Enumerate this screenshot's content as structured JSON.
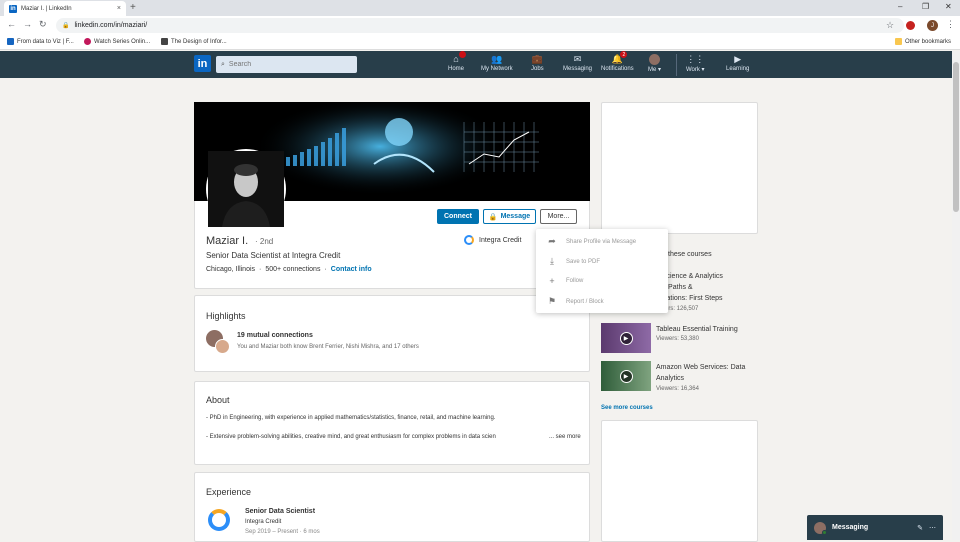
{
  "browser": {
    "tab_title": "Maziar I. | LinkedIn",
    "tab_close": "×",
    "new_tab": "+",
    "url": "linkedin.com/in/maziari/",
    "bookmarks": [
      "From data to Viz | F...",
      "Watch Series Onlin...",
      "The Design of Infor..."
    ],
    "other_bookmarks": "Other bookmarks",
    "profile_initial": "J"
  },
  "linkedin_nav": {
    "logo": "in",
    "search_placeholder": "Search",
    "items": [
      {
        "label": "Home",
        "icon": "home-icon",
        "badge": "•"
      },
      {
        "label": "My Network",
        "icon": "network-icon"
      },
      {
        "label": "Jobs",
        "icon": "jobs-icon"
      },
      {
        "label": "Messaging",
        "icon": "messaging-icon"
      },
      {
        "label": "Notifications",
        "icon": "bell-icon",
        "badge": "2"
      },
      {
        "label": "Me ▾",
        "icon": "me-avatar"
      },
      {
        "label": "Work ▾",
        "icon": "grid-icon"
      },
      {
        "label": "Learning",
        "icon": "learning-icon"
      }
    ]
  },
  "profile": {
    "name": "Maziar I.",
    "degree": "· 2nd",
    "headline": "Senior Data Scientist at Integra Credit",
    "location": "Chicago, Illinois",
    "connections": "500+ connections",
    "separator": "·",
    "contact_info": "Contact info",
    "company": "Integra Credit",
    "connect_label": "Connect",
    "message_label": "Message",
    "more_label": "More..."
  },
  "more_menu": {
    "items": [
      {
        "label": "Share Profile via Message",
        "icon": "share-icon"
      },
      {
        "label": "Save to PDF",
        "icon": "download-icon"
      },
      {
        "label": "Follow",
        "icon": "plus-icon"
      },
      {
        "label": "Report / Block",
        "icon": "flag-icon"
      }
    ]
  },
  "highlights": {
    "title": "Highlights",
    "mutual_title": "19 mutual connections",
    "mutual_sub": "You and Maziar both know Brent Ferrier, Nishi Mishra, and 17 others"
  },
  "about": {
    "title": "About",
    "line1": "- PhD in Engineering, with experience in applied mathematics/statistics, finance, retail, and machine learning.",
    "line2": "- Extensive problem-solving abilities, creative mind, and great enthusiasm for complex problems in data scien",
    "see_more": "... see more"
  },
  "experience": {
    "title": "Experience",
    "role": "Senior Data Scientist",
    "company": "Integra Credit",
    "dates": "Sep 2019 – Present · 6 mos"
  },
  "sidebar": {
    "courses_header": "these courses",
    "courses": [
      {
        "title_lines": [
          "a Science & Analytics",
          "eer Paths &",
          "tifications: First Steps"
        ],
        "viewers": "iewers: 126,507"
      },
      {
        "title_lines": [
          "Tableau Essential Training"
        ],
        "viewers": "Viewers: 53,380"
      },
      {
        "title_lines": [
          "Amazon Web Services: Data",
          "Analytics"
        ],
        "viewers": "Viewers: 16,364"
      }
    ],
    "see_more": "See more courses"
  },
  "messaging": {
    "label": "Messaging"
  },
  "colors": {
    "li_nav": "#283e4a",
    "li_blue": "#0073b1",
    "page_bg": "#f3f2ef"
  }
}
